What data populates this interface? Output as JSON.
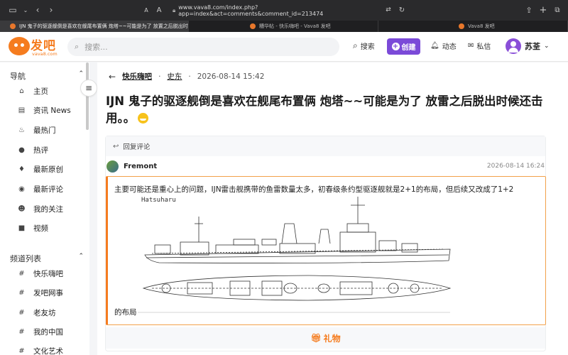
{
  "browser": {
    "url": "www.vava8.com/index.php?app=index&act=comments&comment_id=213474",
    "tabs": [
      {
        "label": "IJN 鬼子的驱逐舰倒是喜欢在舰尾布置俩 炮塔~~可能是为了 放置之后脱出时候..."
      },
      {
        "label": "糟华帖 - 快乐嗨吧 - Vava8 发吧"
      },
      {
        "label": "Vava8 发吧"
      }
    ]
  },
  "header": {
    "logo_name": "发吧",
    "logo_domain": "vava8.com",
    "search_placeholder": "搜索...",
    "search_label": "搜索",
    "create_label": "创建",
    "activity_label": "动态",
    "messages_label": "私信",
    "username": "苏荃"
  },
  "sidebar": {
    "nav_title": "导航",
    "nav_items": [
      {
        "label": "主页",
        "icon": "home-icon"
      },
      {
        "label": "资讯 News",
        "icon": "news-icon"
      },
      {
        "label": "最热门",
        "icon": "fire-icon"
      },
      {
        "label": "热评",
        "icon": "comment-icon"
      },
      {
        "label": "最新原创",
        "icon": "flame-icon"
      },
      {
        "label": "最新评论",
        "icon": "comments-icon"
      },
      {
        "label": "我的关注",
        "icon": "user-follow-icon"
      },
      {
        "label": "视频",
        "icon": "video-icon"
      }
    ],
    "channel_title": "频道列表",
    "channels": [
      {
        "label": "快乐嗨吧"
      },
      {
        "label": "发吧网事"
      },
      {
        "label": "老友坊"
      },
      {
        "label": "我的中国"
      },
      {
        "label": "文化艺术"
      }
    ]
  },
  "post": {
    "board": "快乐嗨吧",
    "author": "史东",
    "date": "2026-08-14 15:42",
    "title": "IJN 鬼子的驱逐舰倒是喜欢在舰尾布置俩 炮塔~~可能是为了 放雷之后脱出时候还击用。。",
    "reply_label": "回复评论",
    "commenter": "Fremont",
    "comment_time": "2026-08-14 16:24",
    "quote_text": "主要可能还是重心上的问题，IJN雷击舰携带的鱼雷数量太多，初春级条约型驱逐舰就是2+1的布局，但后续又改成了1+2",
    "quote_end": "的布局",
    "image_caption": "Hatsuharu",
    "gift_label": "礼物"
  },
  "colors": {
    "brand": "#f57c1f",
    "create_button": "#7b4ad8"
  }
}
